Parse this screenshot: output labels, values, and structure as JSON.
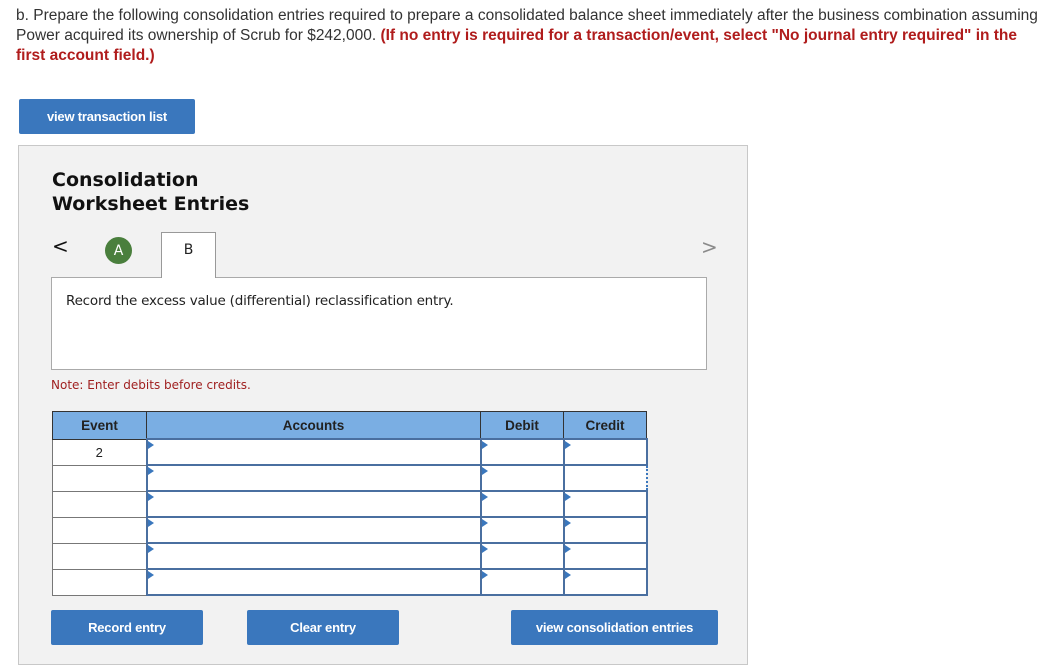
{
  "question": {
    "text": "b. Prepare the following consolidation entries required to prepare a consolidated balance sheet immediately after the business combination assuming Power acquired its ownership of Scrub for  $242,000. ",
    "instruction": "(If no entry is required for a transaction/event, select \"No journal entry required\" in the first account field.)"
  },
  "buttons": {
    "view_transaction_list": "view transaction list",
    "record_entry": "Record entry",
    "clear_entry": "Clear entry",
    "view_consolidation_entries": "view consolidation entries"
  },
  "panel": {
    "title_line1": "Consolidation",
    "title_line2": "Worksheet Entries",
    "nav_prev": "<",
    "nav_next": ">",
    "tabs": [
      {
        "label": "A",
        "state": "completed",
        "color": "#4a7f3d"
      },
      {
        "label": "B",
        "state": "active"
      }
    ],
    "instruction": "Record the excess value (differential) reclassification entry.",
    "note": "Note: Enter debits before credits."
  },
  "table": {
    "columns": [
      "Event",
      "Accounts",
      "Debit",
      "Credit"
    ],
    "rows": [
      {
        "event": "2",
        "account": "",
        "debit": "",
        "credit": ""
      },
      {
        "event": "",
        "account": "",
        "debit": "",
        "credit": ""
      },
      {
        "event": "",
        "account": "",
        "debit": "",
        "credit": ""
      },
      {
        "event": "",
        "account": "",
        "debit": "",
        "credit": ""
      },
      {
        "event": "",
        "account": "",
        "debit": "",
        "credit": ""
      },
      {
        "event": "",
        "account": "",
        "debit": "",
        "credit": ""
      }
    ]
  },
  "colors": {
    "button": "#3a77bd",
    "header": "#7aaee3",
    "accent_red": "#b01c1c"
  }
}
